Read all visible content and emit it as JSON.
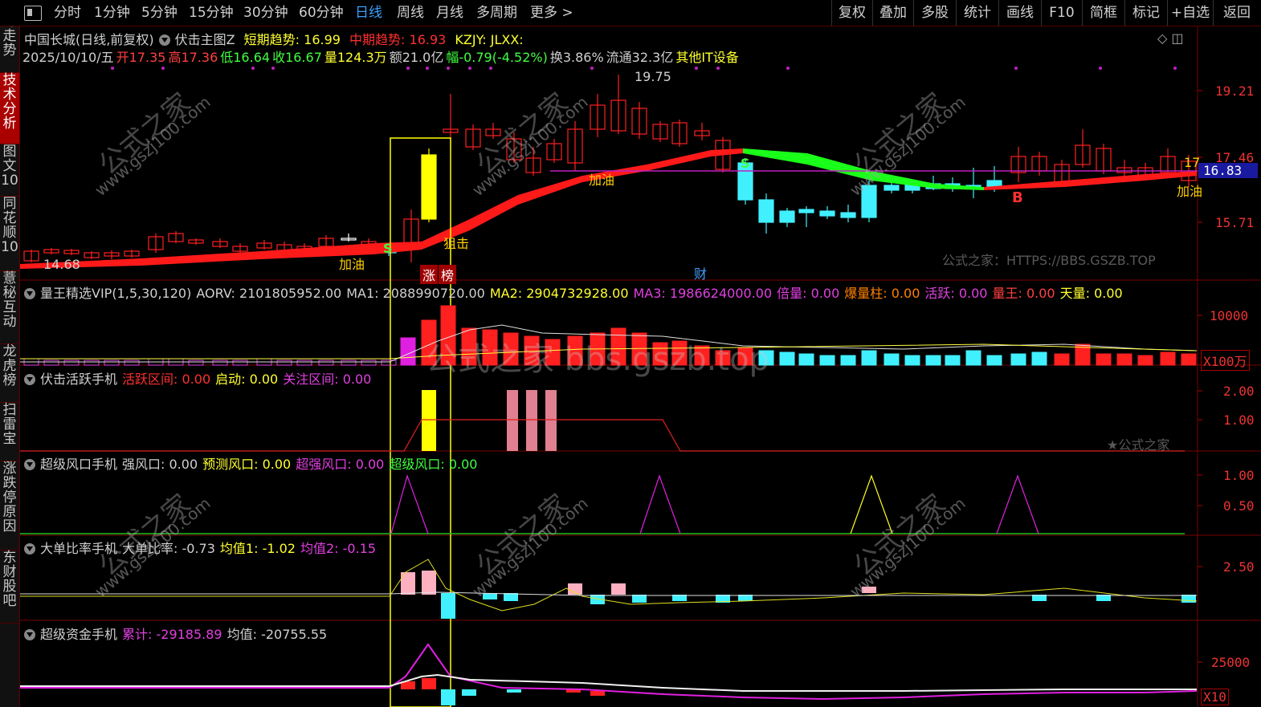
{
  "topbar": {
    "tabs": [
      "分时",
      "1分钟",
      "5分钟",
      "15分钟",
      "30分钟",
      "60分钟",
      "日线",
      "周线",
      "月线",
      "多周期",
      "更多 >"
    ],
    "active_tab": "日线",
    "right_buttons": [
      "复权",
      "叠加",
      "多股",
      "统计",
      "画线",
      "F10",
      "简框",
      "标记",
      "+自选",
      "返回"
    ]
  },
  "sidebar": {
    "items": [
      "分时走势",
      "技术分析",
      "图文10",
      "同花顺10",
      "薏秘互动",
      "龙虎榜",
      "扫雷宝",
      "涨跌停原因",
      "东财股吧"
    ],
    "active": "技术分析"
  },
  "main": {
    "stock": "中国长城(日线,前复权)",
    "indicator": "伏击主图Z",
    "short_trend_label": "短期趋势",
    "short_trend_value": ": 16.99",
    "mid_trend_label": "中期趋势",
    "mid_trend_value": ": 16.93",
    "extra": "KZJY: JLXX:",
    "date": "2025/10/10/五",
    "open": "开17.35",
    "high": "高17.36",
    "low": "低16.64",
    "close": "收16.67",
    "vol": "量124.3万",
    "amount": "额21.0亿",
    "change": "幅-0.79(-4.52%)",
    "turnover": "换3.86%",
    "float": "流通32.3亿",
    "industry": "其他IT设备",
    "y_labels": [
      "19.21",
      "17.46",
      "15.71"
    ],
    "current_price": "16.83",
    "high_mark": "19.75",
    "low_mark": "14.68",
    "annotations": [
      "加油",
      "狙击",
      "加油",
      "加油",
      "涨",
      "榜",
      "财",
      "S",
      "S",
      "B",
      "17"
    ],
    "source": "公式之家：HTTPS://BBS.GSZB.TOP"
  },
  "panel_volume": {
    "name": "量王精选VIP(1,5,30,120)",
    "aorv": "AORV: 2101805952.00",
    "ma1": "MA1: 2088990720.00",
    "ma2": "MA2: 2904732928.00",
    "ma3": "MA3: 1986624000.00",
    "beiliang": "倍量: 0.00",
    "baoliang": "爆量柱: 0.00",
    "huoyue": "活跃: 0.00",
    "liangwang": "量王: 0.00",
    "tianliang": "天量: 0.00",
    "y_label": "10000",
    "unit": "X100万"
  },
  "panel_active": {
    "name": "伏击活跃手机",
    "zone": "活跃区间: 0.00",
    "start": "启动: 0.00",
    "focus": "关注区间: 0.00",
    "y_labels": [
      "2.00",
      "1.00"
    ],
    "wm": "★公式之家"
  },
  "panel_wind": {
    "name": "超级风口手机",
    "strong": "强风口: 0.00",
    "predict": "预测风口: 0.00",
    "super_strong": "超强风口: 0.00",
    "super": "超级风口: 0.00",
    "y_labels": [
      "1.00",
      "0.50"
    ]
  },
  "panel_bigorder": {
    "name": "大单比率手机",
    "ratio": "大单比率: -0.73",
    "avg1": "均值1: -1.02",
    "avg2": "均值2: -0.15",
    "y_label": "2.50"
  },
  "panel_fund": {
    "name": "超级资金手机",
    "cum": "累计: -29185.89",
    "avg": "均值: -20755.55",
    "y_label": "25000",
    "unit": "X10"
  },
  "watermark_big": "公式之家 bbs.gszb.top",
  "watermark_diag": "公式之家",
  "watermark_url": "www.gszj100.com",
  "colors": {
    "up": "#ff2020",
    "down": "#40f0ff",
    "yellow": "#ffff00",
    "magenta": "#e020e0",
    "green": "#20ff20",
    "axis": "#ff3030"
  }
}
